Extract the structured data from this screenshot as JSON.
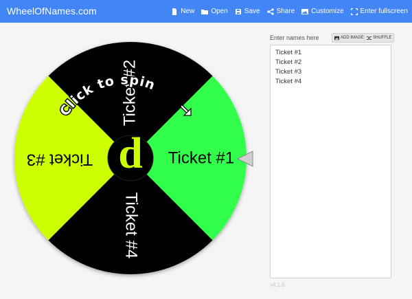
{
  "app": {
    "title": "WheelOfNames.com"
  },
  "menu": [
    {
      "label": "New",
      "icon": "file-icon"
    },
    {
      "label": "Open",
      "icon": "folder-icon"
    },
    {
      "label": "Save",
      "icon": "floppy-icon"
    },
    {
      "label": "Share",
      "icon": "share-icon"
    },
    {
      "label": "Customize",
      "icon": "image-icon"
    },
    {
      "label": "Enter fullscreen",
      "icon": "fullscreen-icon"
    }
  ],
  "wheel": {
    "spin_text": "Click to spin",
    "center_letter": "d",
    "colors": {
      "black": "#000000",
      "green": "#33ff4b",
      "lime": "#ccff00",
      "pointer": "#d0d0d0"
    },
    "segments": [
      {
        "label": "Ticket #1",
        "color": "#33ff4b",
        "text_color": "#000000"
      },
      {
        "label": "Ticket #2",
        "color": "#000000",
        "text_color": "#ffffff"
      },
      {
        "label": "Ticket #3",
        "color": "#ccff00",
        "text_color": "#000000"
      },
      {
        "label": "Ticket #4",
        "color": "#000000",
        "text_color": "#ffffff"
      }
    ]
  },
  "panel": {
    "label": "Enter names here",
    "add_image_label": "ADD IMAGE",
    "shuffle_label": "SHUFFLE",
    "names": [
      "Ticket #1",
      "Ticket #2",
      "Ticket #3",
      "Ticket #4"
    ]
  },
  "version": "v4.1.6"
}
